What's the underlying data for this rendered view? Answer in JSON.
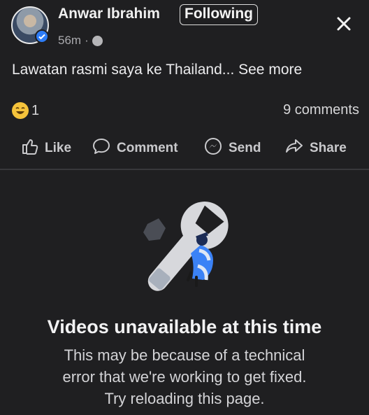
{
  "post": {
    "author": "Anwar Ibrahim",
    "follow_label": "Following",
    "time": "56m",
    "separator": "·",
    "text": "Lawatan rasmi saya ke Thailand...",
    "see_more": "See more",
    "reaction_count": "1",
    "comments": "9 comments"
  },
  "actions": {
    "like": "Like",
    "comment": "Comment",
    "send": "Send",
    "share": "Share"
  },
  "error": {
    "title": "Videos unavailable at this time",
    "line1": "This may be because of a technical",
    "line2": "error that we're working to get fixed.",
    "line3": "Try reloading this page."
  },
  "icons": {
    "close": "close-icon",
    "globe": "globe-icon",
    "verified": "verified-badge-icon",
    "like": "thumbs-up-icon",
    "comment": "comment-bubble-icon",
    "send": "messenger-icon",
    "share": "share-arrow-icon",
    "reaction": "laughing-emoji-icon",
    "error": "wrench-illustration"
  },
  "colors": {
    "background": "#1f1f21",
    "accent": "#2d7cf6"
  }
}
